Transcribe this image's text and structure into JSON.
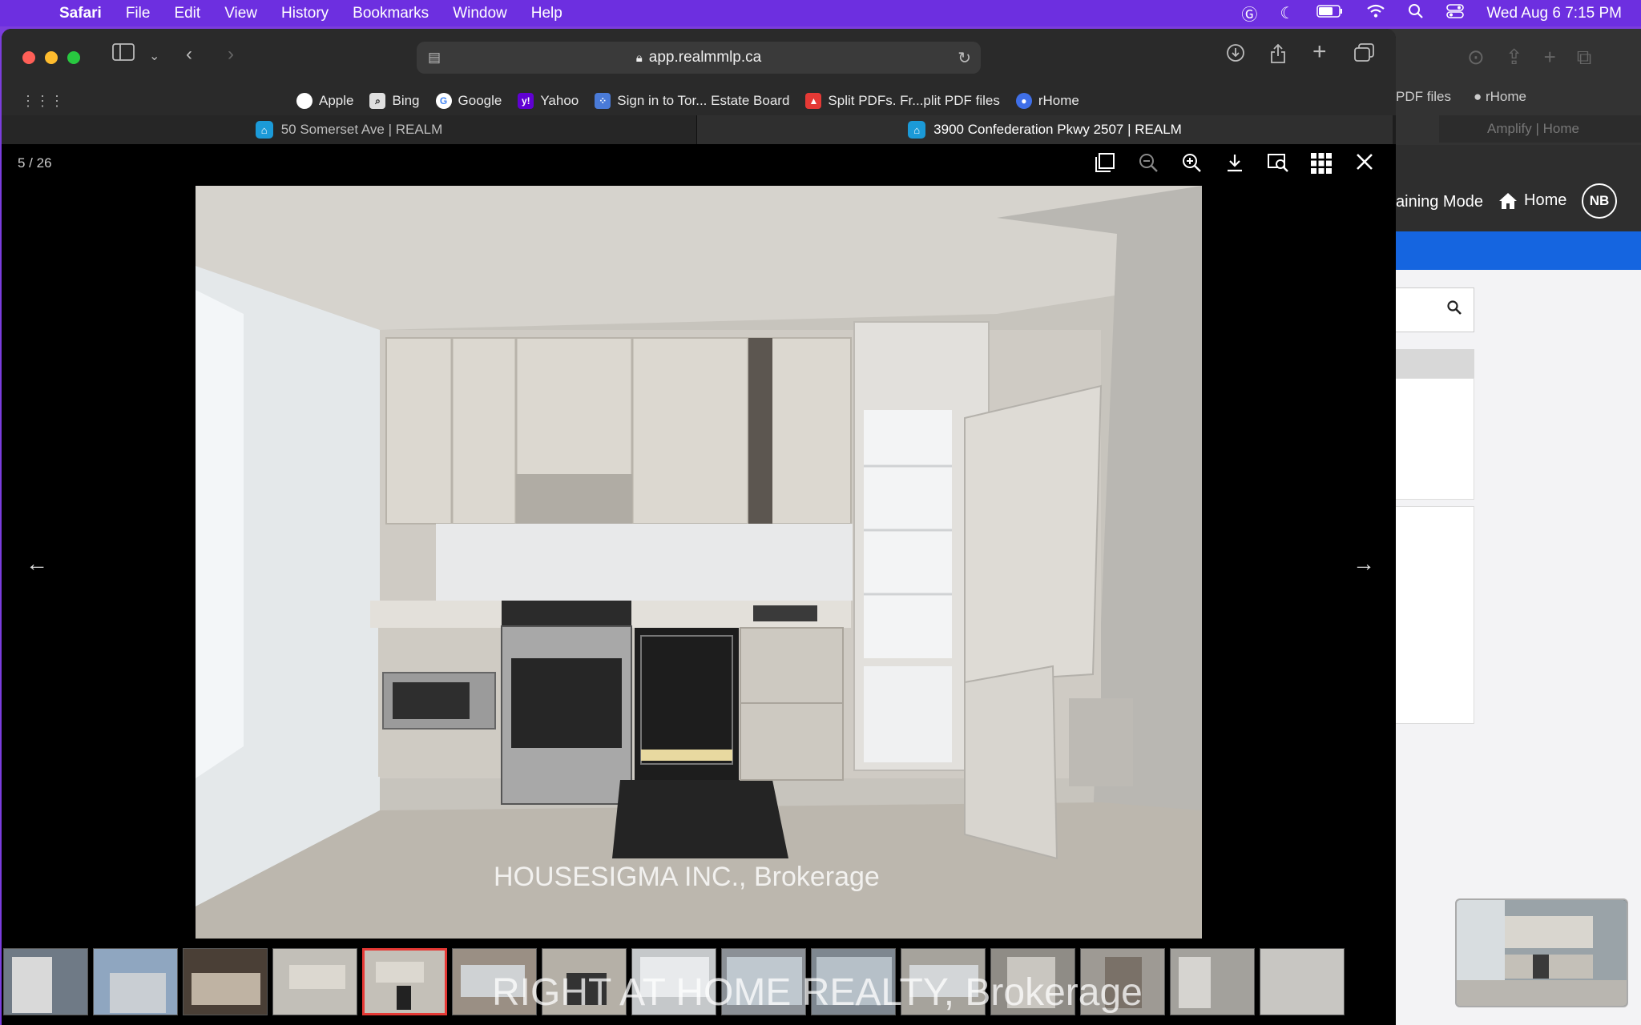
{
  "menubar": {
    "items": [
      "Safari",
      "File",
      "Edit",
      "View",
      "History",
      "Bookmarks",
      "Window",
      "Help"
    ],
    "clock": "Wed Aug 6  7:15 PM"
  },
  "browser": {
    "url": "app.realmmlp.ca",
    "bookmarks": [
      {
        "label": "Apple",
        "icon": "apple-icon",
        "color": "#ffffff"
      },
      {
        "label": "Bing",
        "icon": "bing-icon",
        "color": "#555555"
      },
      {
        "label": "Google",
        "icon": "google-icon",
        "color": "#4285f4"
      },
      {
        "label": "Yahoo",
        "icon": "yahoo-icon",
        "color": "#6001d2"
      },
      {
        "label": "Sign in to Tor... Estate Board",
        "icon": "treb-icon",
        "color": "#4a7bd8"
      },
      {
        "label": "Split PDFs. Fr...plit PDF files",
        "icon": "pdf-icon",
        "color": "#e53935"
      },
      {
        "label": "rHome",
        "icon": "rhome-icon",
        "color": "#3f6fe8"
      }
    ],
    "tabs": [
      {
        "title": "50 Somerset Ave | REALM",
        "active": false
      },
      {
        "title": "3900 Confederation Pkwy 2507 | REALM",
        "active": true
      }
    ]
  },
  "viewer": {
    "counter": "5 / 26",
    "current_index": 5,
    "total": 26,
    "watermark_primary": "HOUSESIGMA INC., Brokerage",
    "watermark_secondary": "RIGHT AT HOME REALTY, Brokerage"
  },
  "background_window": {
    "bookmarks": [
      "PDF files",
      "rHome"
    ],
    "tab": "Amplify | Home",
    "mode_label": "aining Mode",
    "home_label": "Home",
    "avatar_initials": "NB"
  }
}
